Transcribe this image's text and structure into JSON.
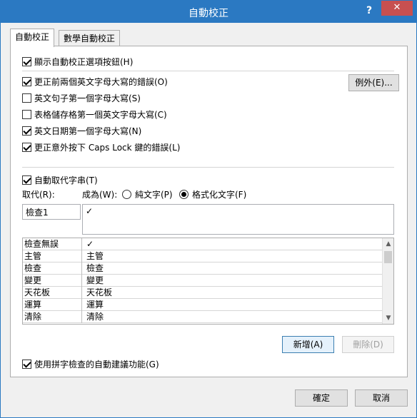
{
  "window": {
    "title": "自動校正",
    "help_label": "?",
    "close_label": "✕"
  },
  "tabs": [
    {
      "label": "自動校正",
      "active": true
    },
    {
      "label": "數學自動校正",
      "active": false
    }
  ],
  "options": {
    "show_buttons": {
      "label": "顯示自動校正選項按鈕(H)",
      "checked": true
    },
    "two_initial_caps": {
      "label": "更正前兩個英文字母大寫的錯誤(O)",
      "checked": true
    },
    "sentence_caps": {
      "label": "英文句子第一個字母大寫(S)",
      "checked": false
    },
    "table_cell_caps": {
      "label": "表格儲存格第一個英文字母大寫(C)",
      "checked": false
    },
    "day_names_caps": {
      "label": "英文日期第一個字母大寫(N)",
      "checked": true
    },
    "caps_lock_fix": {
      "label": "更正意外按下 Caps Lock 鍵的錯誤(L)",
      "checked": true
    }
  },
  "exceptions_button": "例外(E)...",
  "replace_text": {
    "label": "自動取代字串(T)",
    "checked": true
  },
  "replace_label": "取代(R):",
  "with_label": "成為(W):",
  "radio_plain": {
    "label": "純文字(P)",
    "selected": false
  },
  "radio_formatted": {
    "label": "格式化文字(F)",
    "selected": true
  },
  "replace_input_value": "檢查1",
  "with_input_value": "✓",
  "entries": [
    {
      "replace": "檢查無誤",
      "with": "✓"
    },
    {
      "replace": "主管",
      "with": "主管"
    },
    {
      "replace": "檢查",
      "with": "檢查"
    },
    {
      "replace": "變更",
      "with": "變更"
    },
    {
      "replace": "天花板",
      "with": "天花板"
    },
    {
      "replace": "運算",
      "with": "運算"
    },
    {
      "replace": "清除",
      "with": "清除"
    }
  ],
  "scrollbar": {
    "up_icon": "▲",
    "down_icon": "▼"
  },
  "add_button": "新增(A)",
  "delete_button": "刪除(D)",
  "spelling_suggestions": {
    "label": "使用拼字檢查的自動建議功能(G)",
    "checked": true
  },
  "ok_button": "確定",
  "cancel_button": "取消"
}
